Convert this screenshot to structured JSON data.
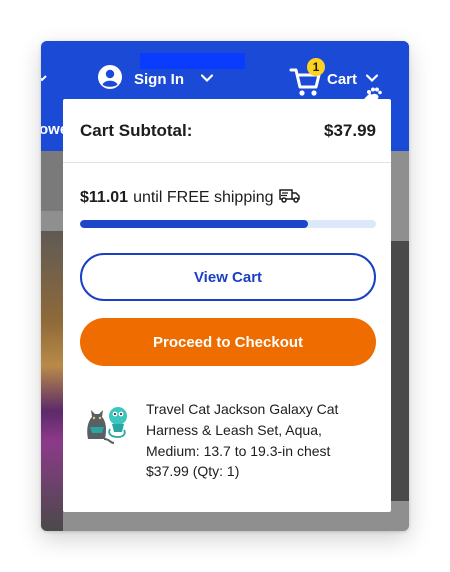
{
  "header": {
    "signin_label": "Sign In",
    "cart_label": "Cart",
    "cart_count": "1",
    "side_text": "owe"
  },
  "dropdown": {
    "subtotal_label": "Cart Subtotal:",
    "subtotal_value": "$37.99",
    "shipping": {
      "amount": "$11.01",
      "text": "until FREE shipping",
      "progress_fraction": 0.77
    },
    "view_cart_label": "View Cart",
    "checkout_label": "Proceed to Checkout",
    "items": [
      {
        "name": "Travel Cat Jackson Galaxy Cat Harness & Leash Set, Aqua, Medium: 13.7 to 19.3-in chest",
        "price_qty": "$37.99 (Qty: 1)"
      }
    ]
  },
  "colors": {
    "brand_blue": "#1b4ad6",
    "badge_yellow": "#ffd21f",
    "checkout_orange": "#ef6c00",
    "progress_fill": "#1d45c8",
    "progress_track": "#dce9f8"
  }
}
